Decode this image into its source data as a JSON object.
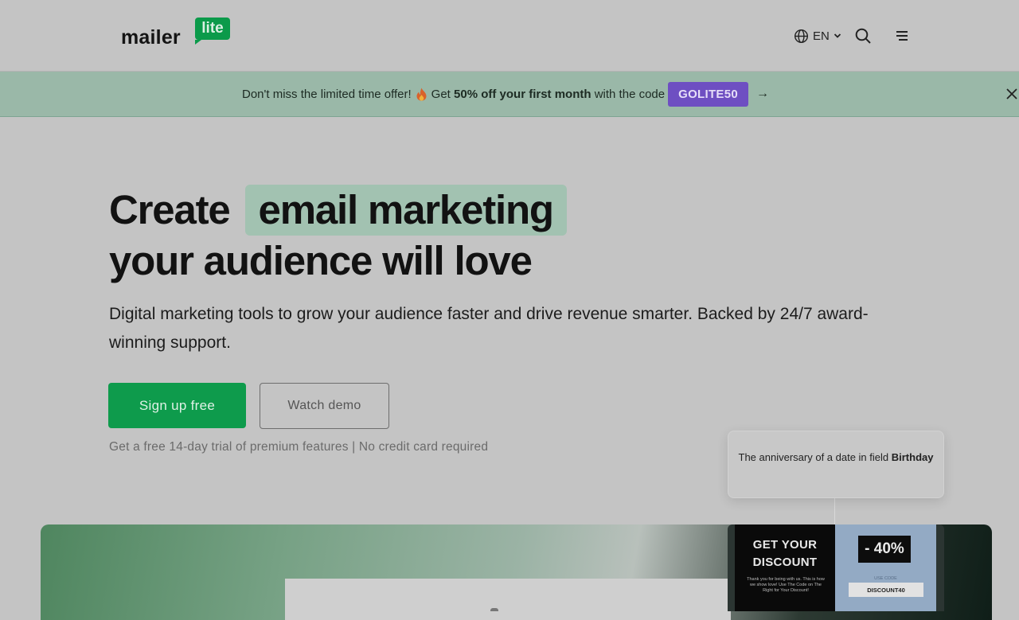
{
  "header": {
    "logo_word": "mailer",
    "logo_badge": "lite",
    "language_code": "EN",
    "icons": [
      "globe-icon",
      "chevron-down-icon",
      "search-icon",
      "menu-icon"
    ]
  },
  "promo": {
    "text_before": "Don't miss the limited time offer!",
    "text_get": "Get",
    "text_bold": "50% off your first month",
    "text_after": "with the code",
    "code": "GOLITE50",
    "arrow": "→"
  },
  "hero": {
    "title_word1": "Create",
    "title_highlight": "email marketing",
    "title_line2": "your audience will love",
    "subtitle": "Digital marketing tools to grow your audience faster and drive revenue smarter. Backed by 24/7 award-winning support.",
    "primary_button": "Sign up free",
    "secondary_button": "Watch demo",
    "trial_note": "Get a free 14-day trial of premium features | No credit card required"
  },
  "tooltip": {
    "text": "The anniversary of a date in field",
    "field": "Birthday"
  },
  "email_preview": {
    "headline": "GET YOUR DISCOUNT",
    "body": "Thank you for being with us. This is how we show love! Use The Code on The Right for Your Discount!",
    "percent": "- 40%",
    "use_label": "USE CODE",
    "code": "DISCOUNT40"
  },
  "colors": {
    "brand_green": "#0e9b4c",
    "promo_code_purple": "#6e4fc2",
    "highlight_green": "#a2c2b1"
  }
}
